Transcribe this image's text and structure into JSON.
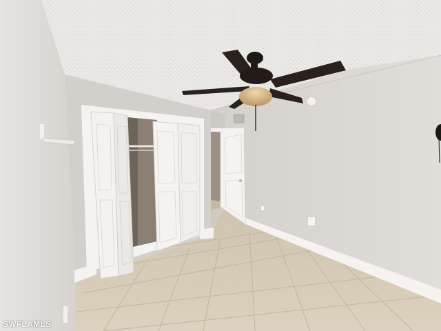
{
  "watermark": "SWFLAMLS",
  "colors": {
    "ceiling": "#ebe9e6",
    "right_wall": "#dcd9d4",
    "back_wall": "#d3cfca",
    "left_wall": "#dedbd7",
    "floor_tile": "#d4c8b4",
    "door_white": "#f3f2ef",
    "fan_blade": "#2a211c",
    "fan_light": "#d9b98a"
  }
}
